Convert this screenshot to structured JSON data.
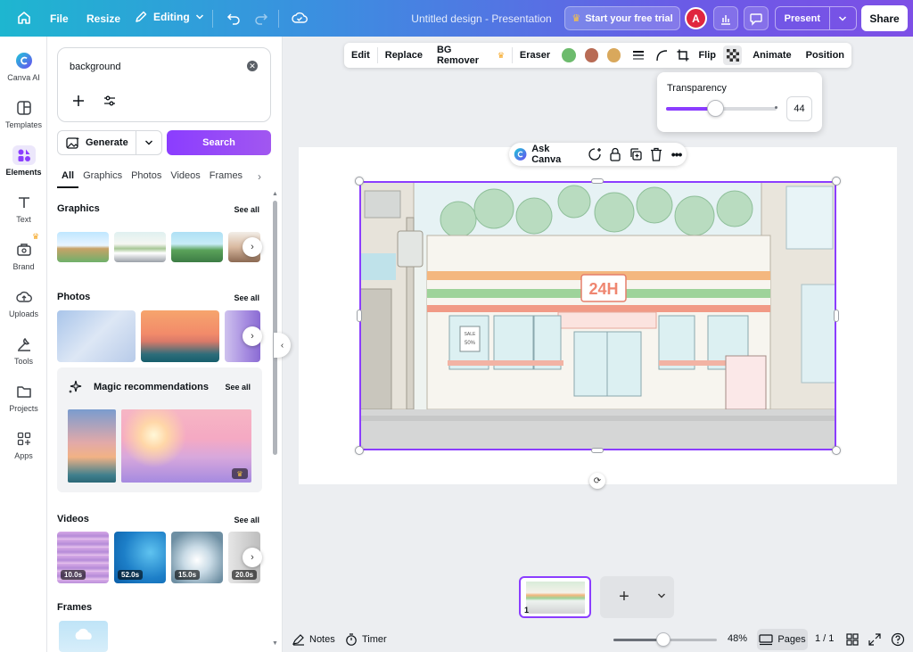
{
  "topbar": {
    "file": "File",
    "resize": "Resize",
    "editing": "Editing",
    "title": "Untitled design - Presentation",
    "trial": "Start your free trial",
    "avatar": "A",
    "present": "Present",
    "share": "Share"
  },
  "rail": [
    {
      "label": "Canva AI",
      "icon": "canva-ai-icon"
    },
    {
      "label": "Templates",
      "icon": "templates-icon"
    },
    {
      "label": "Elements",
      "icon": "elements-icon"
    },
    {
      "label": "Text",
      "icon": "text-icon"
    },
    {
      "label": "Brand",
      "icon": "brand-icon"
    },
    {
      "label": "Uploads",
      "icon": "uploads-icon"
    },
    {
      "label": "Tools",
      "icon": "tools-icon"
    },
    {
      "label": "Projects",
      "icon": "projects-icon"
    },
    {
      "label": "Apps",
      "icon": "apps-icon"
    }
  ],
  "panel": {
    "search_value": "background",
    "generate": "Generate",
    "search": "Search",
    "tabs": [
      "All",
      "Graphics",
      "Photos",
      "Videos",
      "Frames"
    ],
    "sections": {
      "graphics": "Graphics",
      "photos": "Photos",
      "magic": "Magic recommendations",
      "videos": "Videos",
      "frames": "Frames",
      "see_all": "See all"
    },
    "video_durations": [
      "10.0s",
      "52.0s",
      "15.0s",
      "20.0s"
    ]
  },
  "context_toolbar": {
    "edit": "Edit",
    "replace": "Replace",
    "bg_remover": "BG Remover",
    "eraser": "Eraser",
    "colors": [
      "#6dbb6d",
      "#b86b55",
      "#d9a85c"
    ],
    "flip": "Flip",
    "animate": "Animate",
    "position": "Position"
  },
  "transparency": {
    "label": "Transparency",
    "value": "44",
    "level": 0.44
  },
  "floating": {
    "ask_canva": "Ask Canva"
  },
  "scene": {
    "sign": "24H",
    "sale": "SALE",
    "sale_pct": "50%"
  },
  "pages": {
    "thumb_num": "1"
  },
  "bottombar": {
    "notes": "Notes",
    "timer": "Timer",
    "zoom": "48%",
    "zoom_level": 0.48,
    "pages": "Pages",
    "page_count": "1 / 1"
  }
}
